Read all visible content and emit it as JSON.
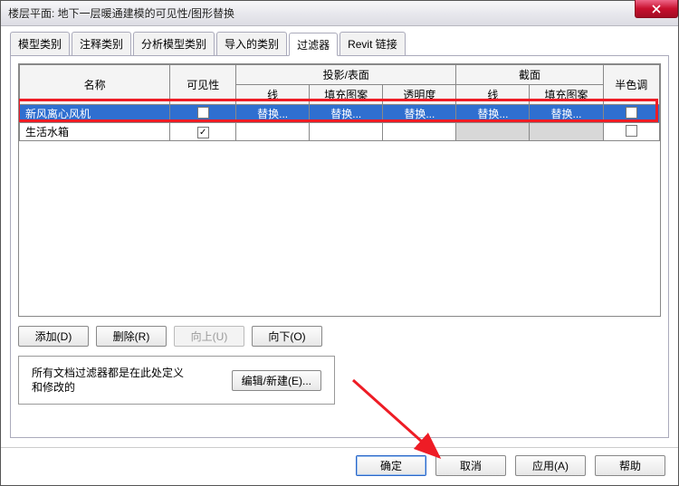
{
  "window": {
    "title": "楼层平面: 地下一层暖通建模的可见性/图形替换"
  },
  "tabs": {
    "items": [
      {
        "label": "模型类别"
      },
      {
        "label": "注释类别"
      },
      {
        "label": "分析模型类别"
      },
      {
        "label": "导入的类别"
      },
      {
        "label": "过滤器"
      },
      {
        "label": "Revit 链接"
      }
    ],
    "active_index": 4
  },
  "grid": {
    "headers": {
      "name": "名称",
      "visibility": "可见性",
      "projection": "投影/表面",
      "section": "截面",
      "halftone": "半色调",
      "sub_line": "线",
      "sub_fill": "填充图案",
      "sub_trans": "透明度"
    },
    "rows": [
      {
        "name": "新风离心风机",
        "visible": false,
        "selected": true,
        "replace": "替换..."
      },
      {
        "name": "生活水箱",
        "visible": true,
        "selected": false,
        "replace": ""
      }
    ]
  },
  "buttons": {
    "add": "添加(D)",
    "remove": "删除(R)",
    "up": "向上(U)",
    "down": "向下(O)",
    "edit_new": "编辑/新建(E)..."
  },
  "hint": "所有文档过滤器都是在此处定义和修改的",
  "footer": {
    "ok": "确定",
    "cancel": "取消",
    "apply": "应用(A)",
    "help": "帮助"
  }
}
